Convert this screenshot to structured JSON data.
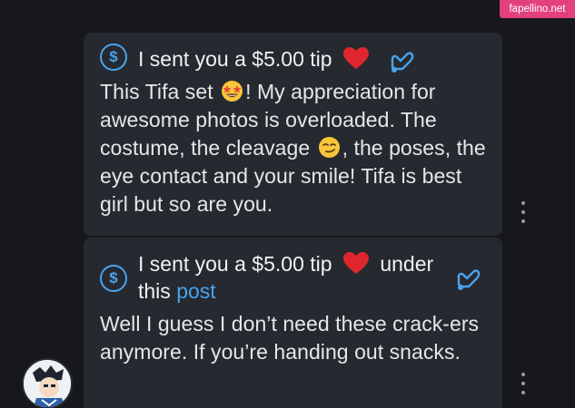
{
  "messages": [
    {
      "tip_text": "I sent you a $5.00 tip",
      "body_parts": [
        "This Tifa set ",
        "! My appreciation for awesome photos is overloaded. The costume, the cleavage ",
        ", the poses, the eye contact and your smile! Tifa is best girl but so are you."
      ],
      "emojis": [
        "star-struck-emoji",
        "smirking-face-emoji"
      ]
    },
    {
      "tip_text": "I sent you a $5.00 tip",
      "tip_suffix": "under",
      "tip_line2": "this ",
      "tip_link": "post",
      "body": "Well I guess I don’t need these crack-ers anymore. If you’re handing out snacks."
    }
  ],
  "watermark": "fapellino.net",
  "colors": {
    "background": "#17181c",
    "bubble": "#26292f",
    "accent": "#4aa3ee",
    "heart": "#e0262d",
    "watermark_bg": "#e2417d"
  },
  "icons": [
    "dollar-circle-icon",
    "heart-icon",
    "coin-hand-icon",
    "more-vertical-icon",
    "avatar"
  ]
}
